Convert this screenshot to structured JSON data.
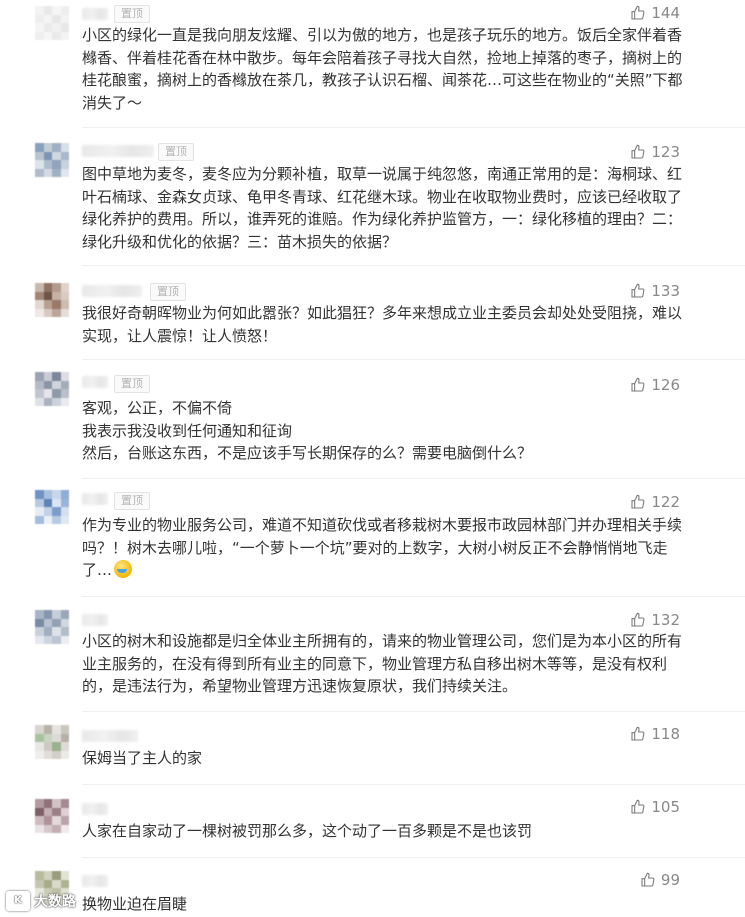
{
  "pinned_label": "置顶",
  "colors": {
    "like_icon": "#7a7a7a",
    "text": "#333333",
    "meta": "#b2b2b2"
  },
  "comments": [
    {
      "likes": "144",
      "pinned": true,
      "text": "小区的绿化一直是我向朋友炫耀、引以为傲的地方，也是孩子玩乐的地方。饭后全家伴着香橼香、伴着桂花香在林中散步。每年会陪着孩子寻找大自然，捡地上掉落的枣子，摘树上的桂花酿蜜，摘树上的香橼放在茶几，教孩子认识石榴、闻茶花…可这些在物业的“关照”下都消失了～"
    },
    {
      "likes": "123",
      "pinned": true,
      "text": "图中草地为麦冬，麦冬应为分颗补植，取草一说属于纯忽悠，南通正常用的是：海桐球、红叶石楠球、金森女贞球、龟甲冬青球、红花继木球。物业在收取物业费时，应该已经收取了绿化养护的费用。所以，谁弄死的谁赔。作为绿化养护监管方，一：绿化移植的理由？二：绿化升级和优化的依据？三：苗木损失的依据？"
    },
    {
      "likes": "133",
      "pinned": true,
      "text": "我很好奇朝晖物业为何如此嚣张？如此猖狂？多年来想成立业主委员会却处处受阻挠，难以实现，让人震惊！让人愤怒！"
    },
    {
      "likes": "126",
      "pinned": true,
      "text": "客观，公正，不偏不倚\n我表示我没收到任何通知和征询\n然后，台账这东西，不是应该手写长期保存的么？需要电脑倒什么？"
    },
    {
      "likes": "122",
      "pinned": true,
      "text": "作为专业的物业服务公司，难道不知道砍伐或者移栽树木要报市政园林部门并办理相关手续吗？！树木去哪儿啦，“一个萝卜一个坑”要对的上数字，大树小树反正不会静悄悄地飞走了…"
    },
    {
      "likes": "132",
      "pinned": false,
      "text": "小区的树木和设施都是归全体业主所拥有的，请来的物业管理公司，您们是为本小区的所有业主服务的，在没有得到所有业主的同意下，物业管理方私自移出树木等等，是没有权利的，是违法行为，希望物业管理方迅速恢复原状，我们持续关注。"
    },
    {
      "likes": "118",
      "pinned": false,
      "text": "保姆当了主人的家"
    },
    {
      "likes": "105",
      "pinned": false,
      "text": "人家在自家动了一棵树被罚那么多，这个动了一百多颗是不是也该罚"
    },
    {
      "likes": "99",
      "pinned": false,
      "text": "换物业迫在眉睫"
    }
  ],
  "watermark": {
    "logo": "K",
    "text": "大数路"
  }
}
